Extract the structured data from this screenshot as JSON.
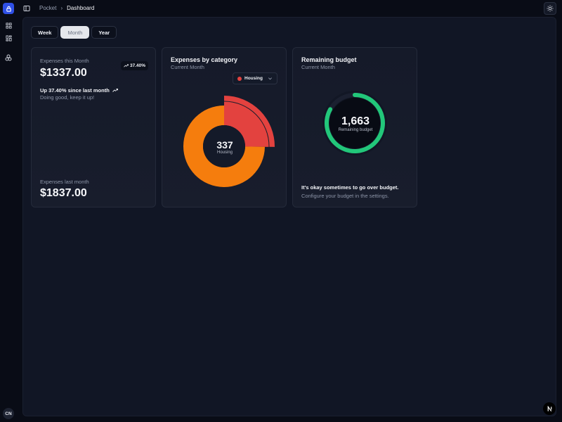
{
  "rail": {
    "logo_icon": "lock-icon",
    "nav_icons": [
      "dashboard-grid-icon",
      "apps-grid-icon",
      "categories-icon"
    ],
    "avatar_initials": "CN"
  },
  "topbar": {
    "breadcrumb_root": "Pocket",
    "breadcrumb_current": "Dashboard",
    "theme_icon": "sun-icon"
  },
  "period_tabs": [
    {
      "label": "Week",
      "active": false
    },
    {
      "label": "Month",
      "active": true
    },
    {
      "label": "Year",
      "active": false
    }
  ],
  "expenses_card": {
    "this_month_label": "Expenses this Month",
    "this_month_value": "$1337.00",
    "badge": "37.40%",
    "trend_text": "Up 37.40% since last month",
    "trend_subtext": "Doing good, keep it up!",
    "last_month_label": "Expenses last month",
    "last_month_value": "$1837.00"
  },
  "category_card": {
    "title": "Expenses by category",
    "subtitle": "Current Month",
    "selected_category": "Housing",
    "center_value": "337",
    "center_label": "Housing"
  },
  "budget_card": {
    "title": "Remaining budget",
    "subtitle": "Current Month",
    "center_value": "1,663",
    "center_label": "Remaining budget",
    "note_title": "It's okay sometimes to go over budget.",
    "note_text": "Configure your budget in the settings."
  },
  "chart_data": [
    {
      "type": "pie",
      "categories": [
        "Housing",
        ""
      ],
      "values": [
        337,
        1000
      ],
      "colors": [
        "#e3423f",
        "#f57d0d"
      ],
      "highlighted": "Housing"
    },
    {
      "type": "pie",
      "categories": [
        "Remaining budget",
        ""
      ],
      "values": [
        1663,
        337
      ],
      "colors": [
        "#22c77a",
        "#1b2030"
      ]
    }
  ],
  "colors": {
    "accent": "#2f50e6",
    "housing": "#e3423f",
    "other": "#f57d0d",
    "budget": "#22c77a"
  },
  "footer": {
    "badge_icon": "n-logo-icon"
  }
}
